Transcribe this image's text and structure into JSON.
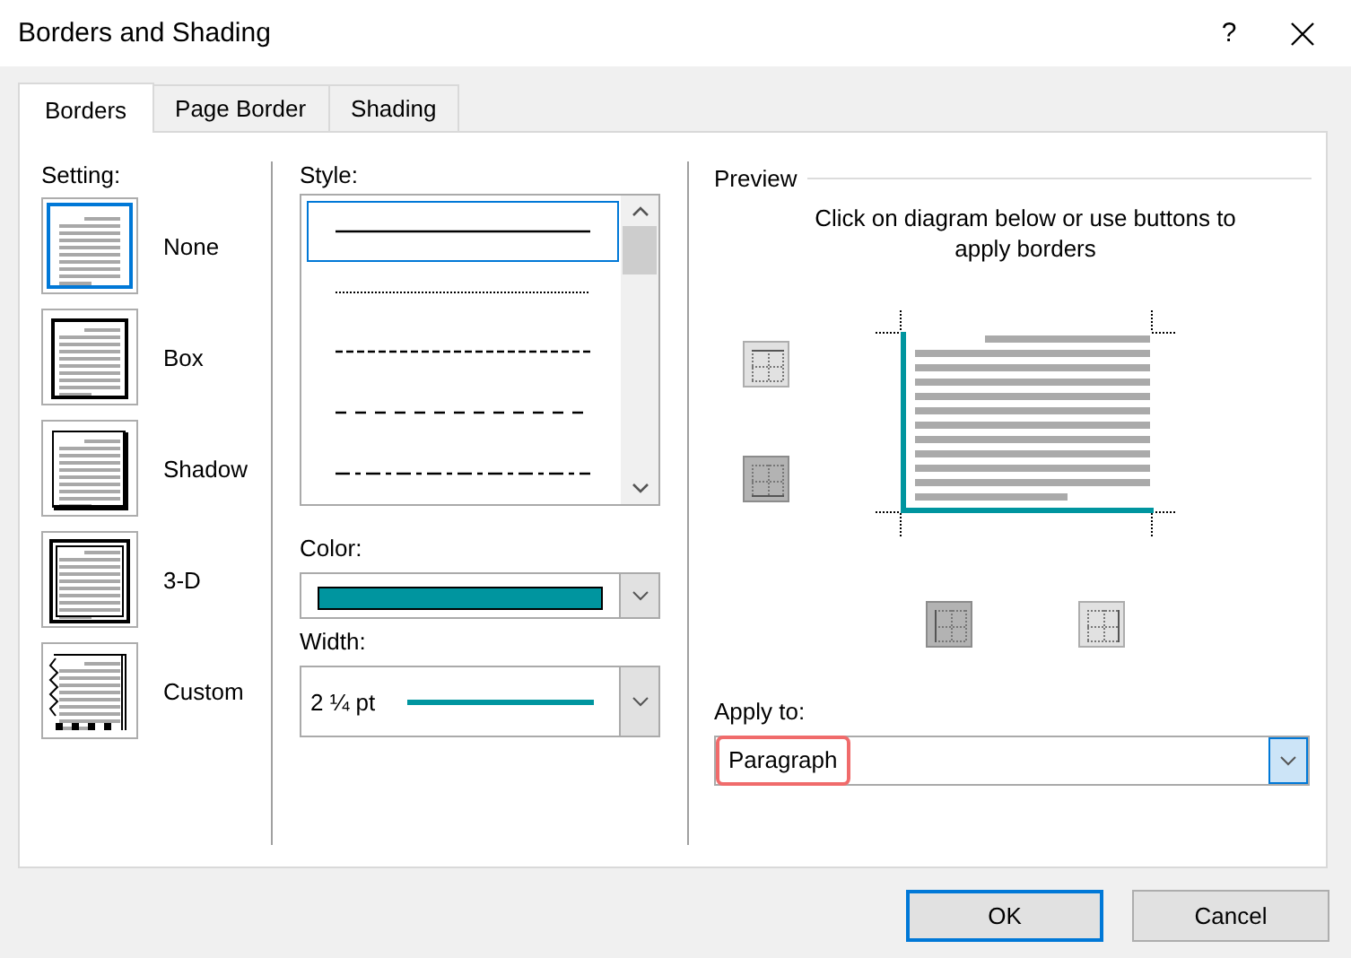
{
  "window": {
    "title": "Borders and Shading",
    "help": "?"
  },
  "tabs": [
    {
      "label": "Borders",
      "selected": true
    },
    {
      "label": "Page Border",
      "selected": false
    },
    {
      "label": "Shading",
      "selected": false
    }
  ],
  "setting": {
    "label": "Setting:",
    "options": [
      {
        "label": "None",
        "kind": "none",
        "selected": true
      },
      {
        "label": "Box",
        "kind": "box",
        "selected": false
      },
      {
        "label": "Shadow",
        "kind": "shadow",
        "selected": false
      },
      {
        "label": "3-D",
        "kind": "threed",
        "selected": false
      },
      {
        "label": "Custom",
        "kind": "custom",
        "selected": false
      }
    ]
  },
  "style": {
    "label": "Style:",
    "lines": [
      {
        "kind": "solid",
        "selected": true
      },
      {
        "kind": "dotted",
        "selected": false
      },
      {
        "kind": "dashed-small",
        "selected": false
      },
      {
        "kind": "dashed",
        "selected": false
      },
      {
        "kind": "dash-dot",
        "selected": false
      }
    ]
  },
  "color": {
    "label": "Color:",
    "color": "#00959f"
  },
  "width": {
    "label": "Width:",
    "value": "2 ¼ pt"
  },
  "preview": {
    "title": "Preview",
    "hint": "Click on diagram below or use buttons to apply borders",
    "borders": [
      {
        "kind": "top",
        "on": false
      },
      {
        "kind": "bottom",
        "on": true
      },
      {
        "kind": "left",
        "on": true
      },
      {
        "kind": "right",
        "on": false
      }
    ]
  },
  "apply_to": {
    "label": "Apply to:",
    "value": "Paragraph",
    "highlighted": true
  },
  "buttons": [
    {
      "label": "OK",
      "default": true
    },
    {
      "label": "Cancel",
      "default": false
    }
  ]
}
